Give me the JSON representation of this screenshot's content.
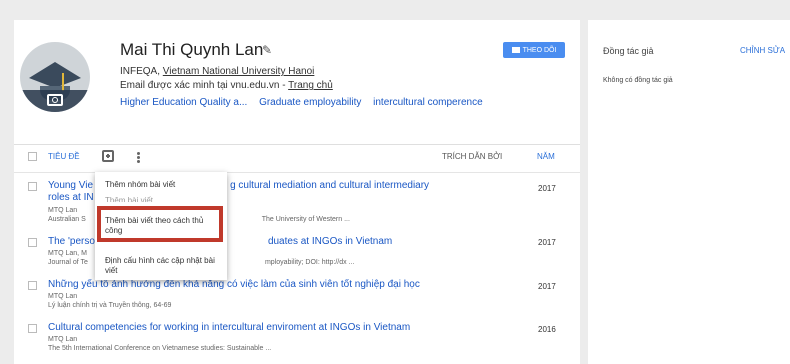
{
  "profile": {
    "name": "Mai Thi Quynh Lan",
    "affiliation_prefix": "INFEQA, ",
    "affiliation_link": "Vietnam National University Hanoi",
    "email_text": "Email được xác minh tại vnu.edu.vn - ",
    "homepage_link": "Trang chủ",
    "interests": [
      "Higher Education Quality a...",
      "Graduate employability",
      "intercultural comperence"
    ],
    "follow_label": "THEO DÕI"
  },
  "table": {
    "col_title": "TIÊU ĐỀ",
    "col_cited": "TRÍCH DẪN BỞI",
    "col_year": "NĂM"
  },
  "articles": [
    {
      "title_a": "Young Vie",
      "title_b": "g cultural mediation and cultural intermediary",
      "title2": "roles at IN",
      "authors": "MTQ Lan",
      "source_a": "Australian S",
      "source_b": "The University of Western ...",
      "year": "2017"
    },
    {
      "title_a": "The 'perso",
      "title_b": "duates at INGOs in Vietnam",
      "authors": "MTQ Lan, M",
      "source_a": "Journal of Te",
      "source_b": "mployability; DOI: http://dx ...",
      "year": "2017"
    },
    {
      "title_a": "Những yếu tố ảnh hưởng đến khả năng có việc làm của sinh viên tốt nghiệp đại học",
      "authors": "MTQ Lan",
      "source": "Lý luận chính trị và Truyền thông, 64-69",
      "year": "2017"
    },
    {
      "title_a": "Cultural competencies for working in intercultural enviroment at INGOs in Vietnam",
      "authors": "MTQ Lan",
      "source": "The 5th International Conference on Vietnamese studies: Sustainable ...",
      "year": "2016"
    }
  ],
  "menu": {
    "add_group": "Thêm nhóm bài viết",
    "add_article_partial": "Thêm bài viết",
    "add_manual": "Thêm bài viết theo cách thủ công",
    "update_settings": "Định cấu hình các cập nhật bài viết"
  },
  "sidebar": {
    "coauthors_title": "Đồng tác giả",
    "edit_label": "CHỈNH SỬA",
    "empty_text": "Không có đồng tác giả"
  },
  "colors": {
    "link": "#1a57c4",
    "follow": "#4a8df0",
    "highlight": "#c0392b"
  },
  "icons": [
    "camera-icon",
    "pencil-icon",
    "envelope-icon",
    "add-article-icon",
    "more-vert-icon"
  ]
}
